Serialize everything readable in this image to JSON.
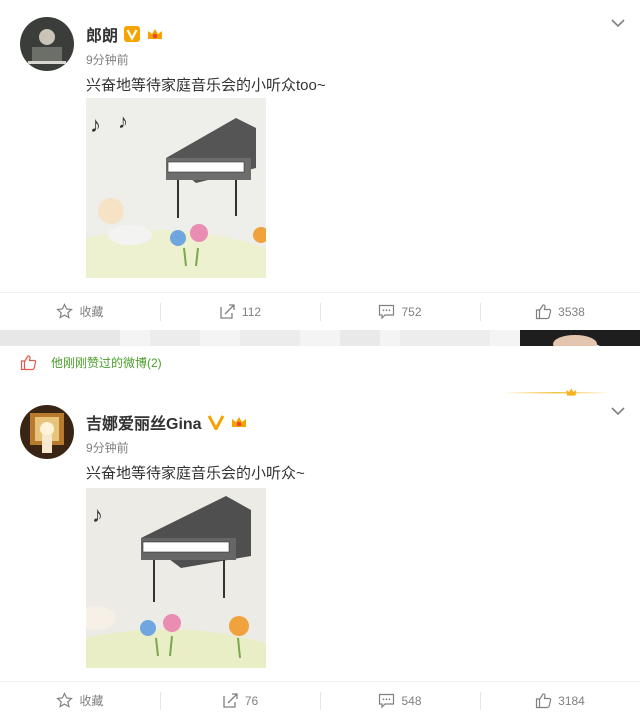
{
  "posts": [
    {
      "name": "郎朗",
      "time": "9分钟前",
      "text": "兴奋地等待家庭音乐会的小听众too~",
      "actions": {
        "favorite": "收藏",
        "repost": "112",
        "comment": "752",
        "like": "3538"
      }
    },
    {
      "name": "吉娜爱丽丝Gina",
      "time": "9分钟前",
      "text": "兴奋地等待家庭音乐会的小听众~",
      "actions": {
        "favorite": "收藏",
        "repost": "76",
        "comment": "548",
        "like": "3184"
      }
    }
  ],
  "liked_bar": {
    "text": "他刚刚赞过的微博(2)"
  },
  "icons": {
    "verified": "verified-v-icon",
    "vip": "vip-crown-icon",
    "more": "chevron-down-icon",
    "favorite": "star-icon",
    "repost": "repost-icon",
    "comment": "comment-icon",
    "like": "thumbs-up-icon"
  },
  "colors": {
    "verified": "#f5a300",
    "liked_text": "#4a9f2a",
    "muted": "#808080",
    "text": "#333333"
  }
}
